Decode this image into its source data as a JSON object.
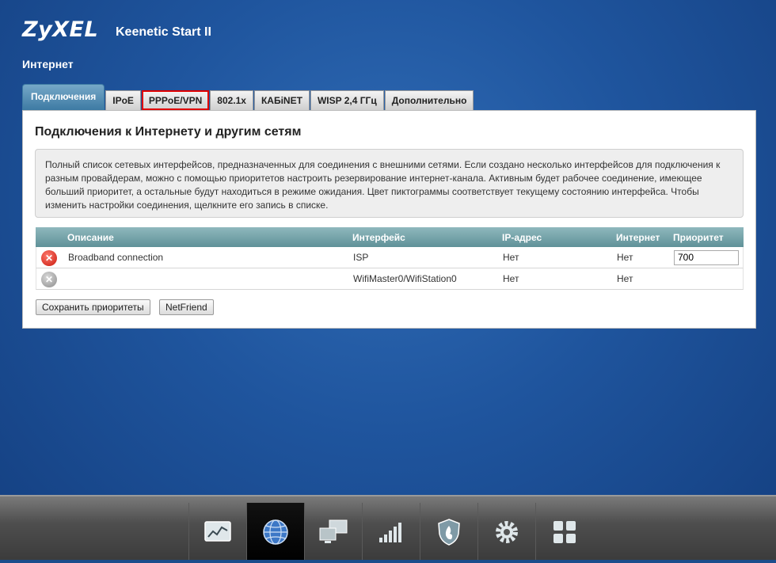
{
  "brand": {
    "logo": "ZyXEL",
    "model": "Keenetic Start II"
  },
  "page": {
    "section": "Интернет"
  },
  "tabs": [
    {
      "label": "Подключения",
      "active": true
    },
    {
      "label": "IPoE"
    },
    {
      "label": "PPPoE/VPN",
      "highlighted": true
    },
    {
      "label": "802.1x"
    },
    {
      "label": "КАБiNET"
    },
    {
      "label": "WISP 2,4 ГГц"
    },
    {
      "label": "Дополнительно"
    }
  ],
  "panel": {
    "title": "Подключения к Интернету и другим сетям",
    "info": "Полный список сетевых интерфейсов, предназначенных для соединения с внешними сетями. Если создано несколько интерфейсов для подключения к разным провайдерам, можно с помощью приоритетов настроить резервирование интернет-канала. Активным будет рабочее соединение, имеющее больший приоритет, а остальные будут находиться в режиме ожидания. Цвет пиктограммы соответствует текущему состоянию интерфейса. Чтобы изменить настройки соединения, щелкните его запись в списке."
  },
  "table": {
    "headers": {
      "description": "Описание",
      "interface": "Интерфейс",
      "ip": "IP-адрес",
      "internet": "Интернет",
      "priority": "Приоритет"
    },
    "rows": [
      {
        "status": "error",
        "description": "Broadband connection",
        "interface": "ISP",
        "ip": "Нет",
        "internet": "Нет",
        "priority": "700"
      },
      {
        "status": "inactive",
        "description": "",
        "interface": "WifiMaster0/WifiStation0",
        "ip": "Нет",
        "internet": "Нет",
        "priority": ""
      }
    ]
  },
  "buttons": {
    "save": "Сохранить приоритеты",
    "netfriend": "NetFriend"
  },
  "dock": [
    "monitor-icon",
    "globe-icon",
    "network-icon",
    "signal-icon",
    "shield-icon",
    "gear-icon",
    "apps-icon"
  ],
  "colors": {
    "accent_red": "#e00000",
    "table_header": "#5f9198",
    "active_tab": "#3d7aa3"
  }
}
